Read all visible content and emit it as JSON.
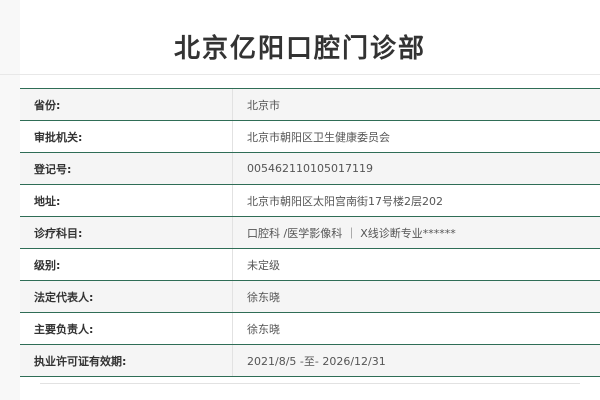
{
  "page": {
    "title": "北京亿阳口腔门诊部"
  },
  "info_table": {
    "rows": [
      {
        "label": "省份:",
        "value": "北京市"
      },
      {
        "label": "审批机关:",
        "value": "北京市朝阳区卫生健康委员会"
      },
      {
        "label": "登记号:",
        "value": "005462110105017119"
      },
      {
        "label": "地址:",
        "value": "北京市朝阳区太阳宫南街17号楼2层202"
      },
      {
        "label": "诊疗科目:",
        "value": "口腔科 /医学影像科 ｜ X线诊断专业******"
      },
      {
        "label": "级别:",
        "value": "未定级"
      },
      {
        "label": "法定代表人:",
        "value": "徐东晓"
      },
      {
        "label": "主要负责人:",
        "value": "徐东晓"
      },
      {
        "label": "执业许可证有效期:",
        "value": "2021/8/5 -至- 2026/12/31"
      }
    ]
  },
  "colors": {
    "accent_line": "#2f6d56",
    "row_shade": "#f5f5f5",
    "background": "#f8f8f8"
  }
}
